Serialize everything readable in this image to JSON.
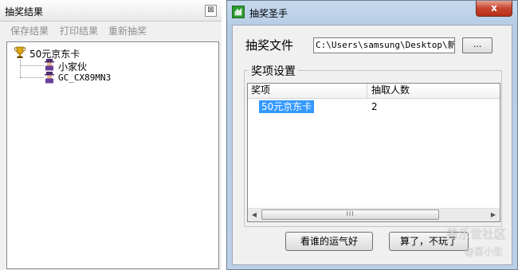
{
  "results_panel": {
    "title": "抽奖结果",
    "close_glyph": "⊠",
    "menu": [
      "保存结果",
      "打印结果",
      "重新抽奖"
    ],
    "tree": {
      "root_label": "50元京东卡",
      "children": [
        "小家伙",
        "GC_CX89MN3"
      ]
    }
  },
  "dialog": {
    "title": "抽奖圣手",
    "close_glyph": "x",
    "file_label": "抽奖文件",
    "file_path": "C:\\Users\\samsung\\Desktop\\新建",
    "browse_label": "...",
    "group_title": "奖项设置",
    "columns": [
      "奖项",
      "抽取人数"
    ],
    "rows": [
      {
        "prize": "50元京东卡",
        "count": "2"
      }
    ],
    "scroll_thumb_grip": "III",
    "lottery_button": "看谁的运气好",
    "quit_button": "算了，不玩了"
  },
  "watermark": {
    "line1": "善乐世社区",
    "line2": "@百小生"
  },
  "colors": {
    "selection": "#3399ff",
    "dialog_frame": "#bcd1e8",
    "close_button": "#c7442e"
  }
}
